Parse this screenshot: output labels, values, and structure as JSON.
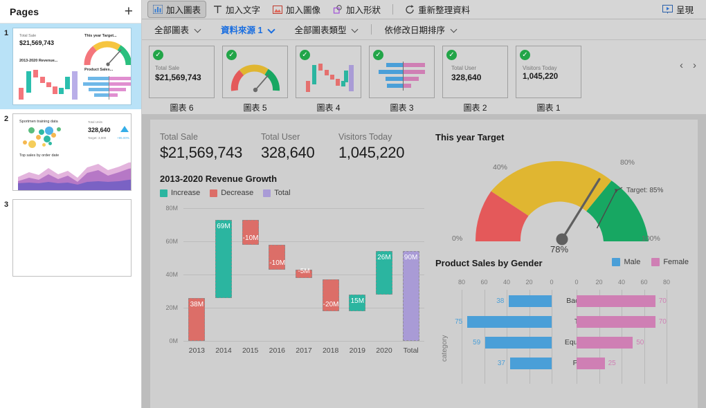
{
  "sidebar": {
    "title": "Pages",
    "add_icon": "plus-icon",
    "pages": [
      {
        "number": "1",
        "selected": true,
        "thumb": {
          "kpi_label": "Total Sale",
          "kpi_value": "$21,569,743",
          "gauge_title": "This year Target...",
          "waterfall_title": "2013-2020 Revenue...",
          "butterfly_title": "Product Sales..."
        }
      },
      {
        "number": "2",
        "selected": false,
        "thumb": {
          "bubble_title": "Sportmen training data",
          "kpi_label": "Total Units",
          "kpi_value": "328,640",
          "target_label": "Target: 3,000",
          "delta": "+95.00%",
          "area_title": "Top sales by order date"
        }
      },
      {
        "number": "3",
        "selected": false,
        "thumb": {}
      }
    ]
  },
  "toolbar": {
    "add_chart": "加入圖表",
    "add_chart_icon": "bar-chart-icon",
    "add_text": "加入文字",
    "add_text_icon": "text-T-icon",
    "add_image": "加入圖像",
    "add_image_icon": "image-icon",
    "add_shape": "加入形狀",
    "add_shape_icon": "shape-icon",
    "refresh_data": "重新整理資料",
    "refresh_icon": "refresh-icon",
    "present": "呈現",
    "present_icon": "present-icon"
  },
  "filterbar": {
    "all_charts": "全部圖表",
    "data_source": "資料來源 1",
    "all_chart_types": "全部圖表類型",
    "sort_by": "依修改日期排序",
    "accent_color": "#1a6ee0"
  },
  "strip": {
    "prev_icon": "chevron-left-icon",
    "next_icon": "chevron-right-icon",
    "cards": [
      {
        "label": "圖表 6",
        "kind": "kpi",
        "kpi_label": "Total Sale",
        "kpi_value": "$21,569,743",
        "status": "checked"
      },
      {
        "label": "圖表 5",
        "kind": "gauge",
        "status": "checked"
      },
      {
        "label": "圖表 4",
        "kind": "waterfall",
        "status": "checked"
      },
      {
        "label": "圖表 3",
        "kind": "butterfly",
        "status": "checked"
      },
      {
        "label": "圖表 2",
        "kind": "kpi",
        "kpi_label": "Total User",
        "kpi_value": "328,640",
        "status": "checked"
      },
      {
        "label": "圖表 1",
        "kind": "kpi",
        "kpi_label": "Visitors Today",
        "kpi_value": "1,045,220",
        "status": "checked"
      }
    ]
  },
  "canvas": {
    "kpis": [
      {
        "label": "Total Sale",
        "value": "$21,569,743"
      },
      {
        "label": "Total User",
        "value": "328,640"
      },
      {
        "label": "Visitors Today",
        "value": "1,045,220"
      }
    ],
    "waterfall_title": "2013-2020 Revenue Growth",
    "gauge_title": "This year Target",
    "butterfly_title": "Product Sales by Gender"
  },
  "chart_data": [
    {
      "type": "bar",
      "subtype": "waterfall",
      "title": "2013-2020 Revenue Growth",
      "xlabel": "",
      "ylabel": "",
      "ylim": [
        0,
        80
      ],
      "ytick_labels": [
        "0M",
        "20M",
        "40M",
        "60M",
        "80M"
      ],
      "yticks": [
        0,
        20,
        40,
        60,
        80
      ],
      "grid": true,
      "legend": [
        "Increase",
        "Decrease",
        "Total"
      ],
      "legend_position": "top-left",
      "colors": {
        "increase": "#2bb5a0",
        "decrease": "#dc6e68",
        "total": "#a99bd6"
      },
      "categories": [
        "2013",
        "2014",
        "2015",
        "2016",
        "2017",
        "2018",
        "2019",
        "2020",
        "Total"
      ],
      "labels": [
        "38M",
        "69M",
        "-10M",
        "-10M",
        "-5M",
        "-20M",
        "15M",
        "26M",
        "90M"
      ],
      "values": [
        38,
        69,
        -10,
        -10,
        -5,
        -20,
        15,
        26,
        90
      ],
      "kinds": [
        "decrease",
        "increase",
        "decrease",
        "decrease",
        "decrease",
        "decrease",
        "increase",
        "increase",
        "total"
      ],
      "bar_start": [
        0,
        26,
        58,
        43,
        38,
        18,
        18,
        28,
        0
      ],
      "bar_end": [
        26,
        73,
        73,
        58,
        43,
        37,
        28,
        54,
        54
      ]
    },
    {
      "type": "gauge",
      "title": "This year Target",
      "value": 78,
      "value_label": "78%",
      "target": 85,
      "target_label": "Target: 85%",
      "min": 0,
      "max": 100,
      "tick_labels": [
        "0%",
        "40%",
        "80%",
        "100%"
      ],
      "ticks": [
        0,
        40,
        80,
        100
      ],
      "bands": [
        {
          "from": 0,
          "to": 33,
          "color": "#e4595a"
        },
        {
          "from": 33,
          "to": 72,
          "color": "#e0b631"
        },
        {
          "from": 72,
          "to": 100,
          "color": "#17a762"
        }
      ],
      "needle_color": "#5f5f5f"
    },
    {
      "type": "bar",
      "subtype": "butterfly",
      "title": "Product Sales by Gender",
      "ylabel": "category",
      "categories": [
        "Backpack",
        "Tops",
        "Equipment",
        "Pants"
      ],
      "legend_position": "top-right",
      "xlim": [
        0,
        80
      ],
      "left_axis_ticks": [
        80,
        60,
        40,
        20,
        0
      ],
      "right_axis_ticks": [
        0,
        20,
        40,
        60,
        80
      ],
      "series": [
        {
          "name": "Male",
          "color": "#4a9fd8",
          "side": "left",
          "values": [
            38,
            75,
            59,
            37
          ]
        },
        {
          "name": "Female",
          "color": "#cf7fb4",
          "side": "right",
          "values": [
            70,
            70,
            50,
            25
          ]
        }
      ]
    }
  ]
}
